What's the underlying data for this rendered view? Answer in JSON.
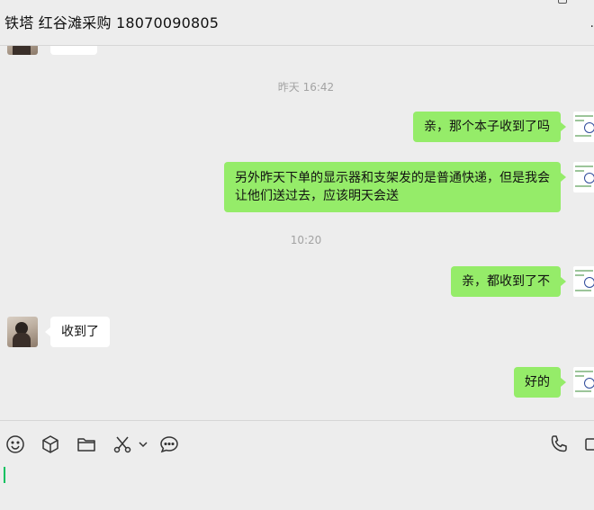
{
  "header": {
    "title": "铁塔 红谷滩采购 18070090805",
    "more_label": "·"
  },
  "messages": [
    {
      "type": "timestamp",
      "text": "昨天 16:42"
    },
    {
      "type": "sent",
      "text": "亲，那个本子收到了吗"
    },
    {
      "type": "sent",
      "lines": [
        "另外昨天下单的显示器和支架发的是普通快递，但是我会",
        "让他们送过去，应该明天会送"
      ]
    },
    {
      "type": "timestamp",
      "text": "10:20"
    },
    {
      "type": "sent",
      "text": "亲，都收到了不"
    },
    {
      "type": "received",
      "text": "收到了"
    },
    {
      "type": "sent",
      "text": "好的"
    }
  ],
  "toolbar": {
    "icons": [
      "emoji-icon",
      "box-icon",
      "folder-icon",
      "scissors-icon",
      "chevron-down-icon",
      "chat-bubble-icon",
      "phone-icon",
      "video-icon"
    ]
  },
  "colors": {
    "sent_bubble": "#95ec69",
    "received_bubble": "#ffffff",
    "background": "#ededed",
    "cursor": "#07c160"
  }
}
